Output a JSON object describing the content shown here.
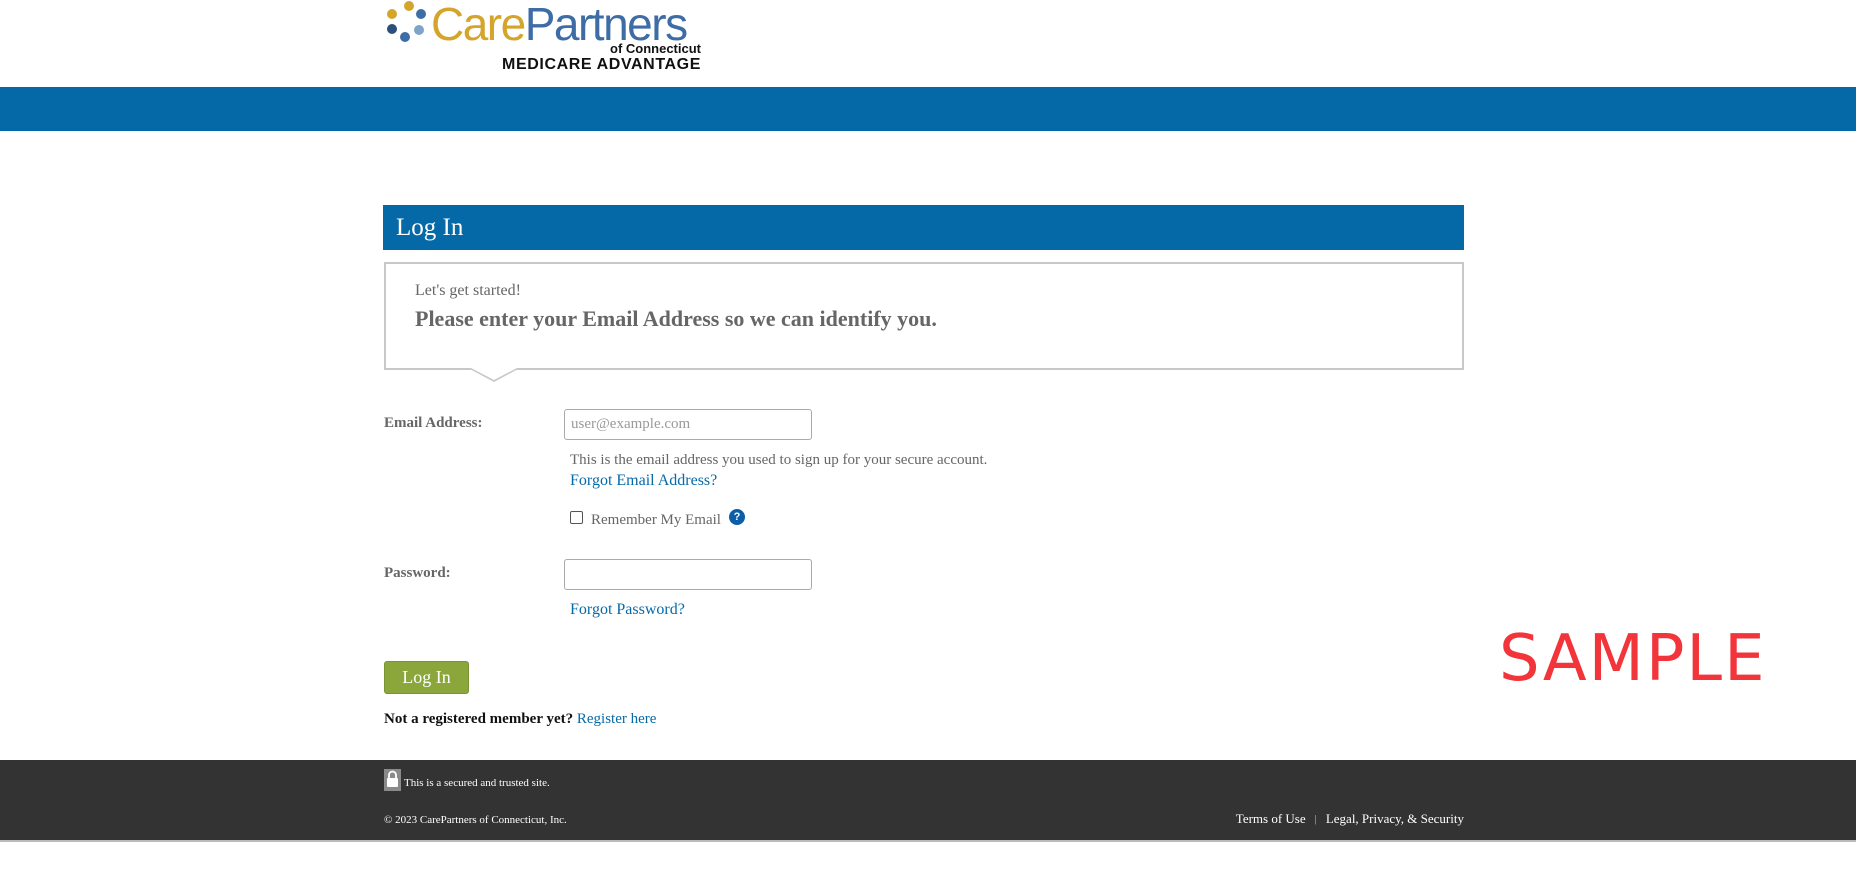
{
  "header": {
    "logo": {
      "brand_care": "Care",
      "brand_partners": "Partners",
      "subline": "of Connecticut",
      "product": "MEDICARE ADVANTAGE",
      "colors": {
        "care": "#d4a52a",
        "partners": "#3e6da6"
      }
    }
  },
  "login": {
    "title": "Log In",
    "intro_small": "Let's get started!",
    "intro_big": "Please enter your Email Address so we can identify you.",
    "email_label": "Email Address:",
    "email_placeholder": "user@example.com",
    "email_value": "",
    "email_helper": "This is the email address you used to sign up for your secure account.",
    "forgot_email": "Forgot Email Address?",
    "remember_label": "Remember My Email",
    "remember_checked": false,
    "help_icon": "?",
    "password_label": "Password:",
    "password_value": "",
    "forgot_password": "Forgot Password?",
    "submit_label": "Log In",
    "register_question": "Not a registered member yet?",
    "register_link": "Register here"
  },
  "watermark": "SAMPLE",
  "footer": {
    "secure_text": "This is a secured and trusted site.",
    "copyright": "© 2023 CarePartners of Connecticut, Inc.",
    "links": [
      "Terms of Use",
      "Legal, Privacy, & Security"
    ],
    "separator": "|"
  },
  "colors": {
    "primary_blue": "#0569a8",
    "button_green": "#8ba63a",
    "footer_bg": "#333333",
    "watermark_red": "#f2353a"
  },
  "icons": {
    "help": "question-circle-icon",
    "lock": "lock-icon",
    "logo_mark": "people-circle-logo"
  }
}
